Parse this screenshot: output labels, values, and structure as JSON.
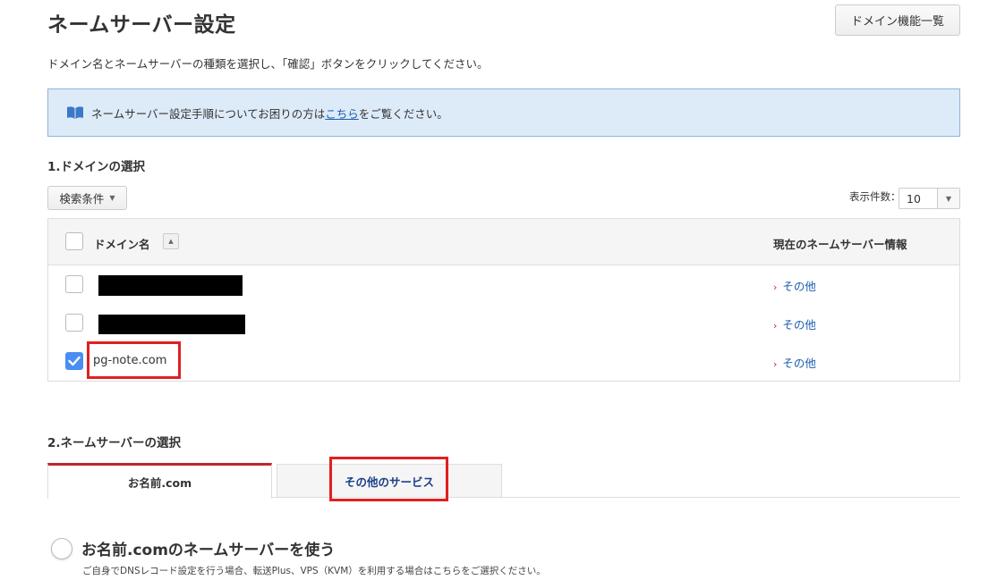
{
  "header": {
    "title": "ネームサーバー設定",
    "domain_list_button": "ドメイン機能一覧"
  },
  "intro": "ドメイン名とネームサーバーの種類を選択し、「確認」ボタンをクリックしてください。",
  "info": {
    "text_before": "ネームサーバー設定手順についてお困りの方は",
    "link": "こちら",
    "text_after": "をご覧ください。"
  },
  "domain_section": {
    "heading": "1.ドメインの選択",
    "filter_button": "検索条件",
    "per_page_label": "表示件数：",
    "per_page_value": "10",
    "columns": {
      "domain": "ドメイン名",
      "current_ns": "現在のネームサーバー情報"
    },
    "rows": [
      {
        "domain": "",
        "redacted": true,
        "checked": false,
        "ns": "その他"
      },
      {
        "domain": "",
        "redacted": true,
        "checked": false,
        "ns": "その他"
      },
      {
        "domain": "pg-note.com",
        "redacted": false,
        "checked": true,
        "ns": "その他"
      }
    ]
  },
  "ns_section": {
    "heading": "2.ネームサーバーの選択",
    "tabs": [
      {
        "label": "お名前.com",
        "active": true
      },
      {
        "label": "その他のサービス",
        "active": false
      }
    ],
    "option_label": "お名前.comのネームサーバーを使う",
    "option_desc": "ご自身でDNSレコード設定を行う場合、転送Plus、VPS（KVM）を利用する場合はこちらをご選択ください。"
  },
  "colors": {
    "accent_red": "#c1272d",
    "link_blue": "#1a5cb0",
    "info_bg": "#ddeaf8",
    "highlight_red": "#e02020"
  }
}
